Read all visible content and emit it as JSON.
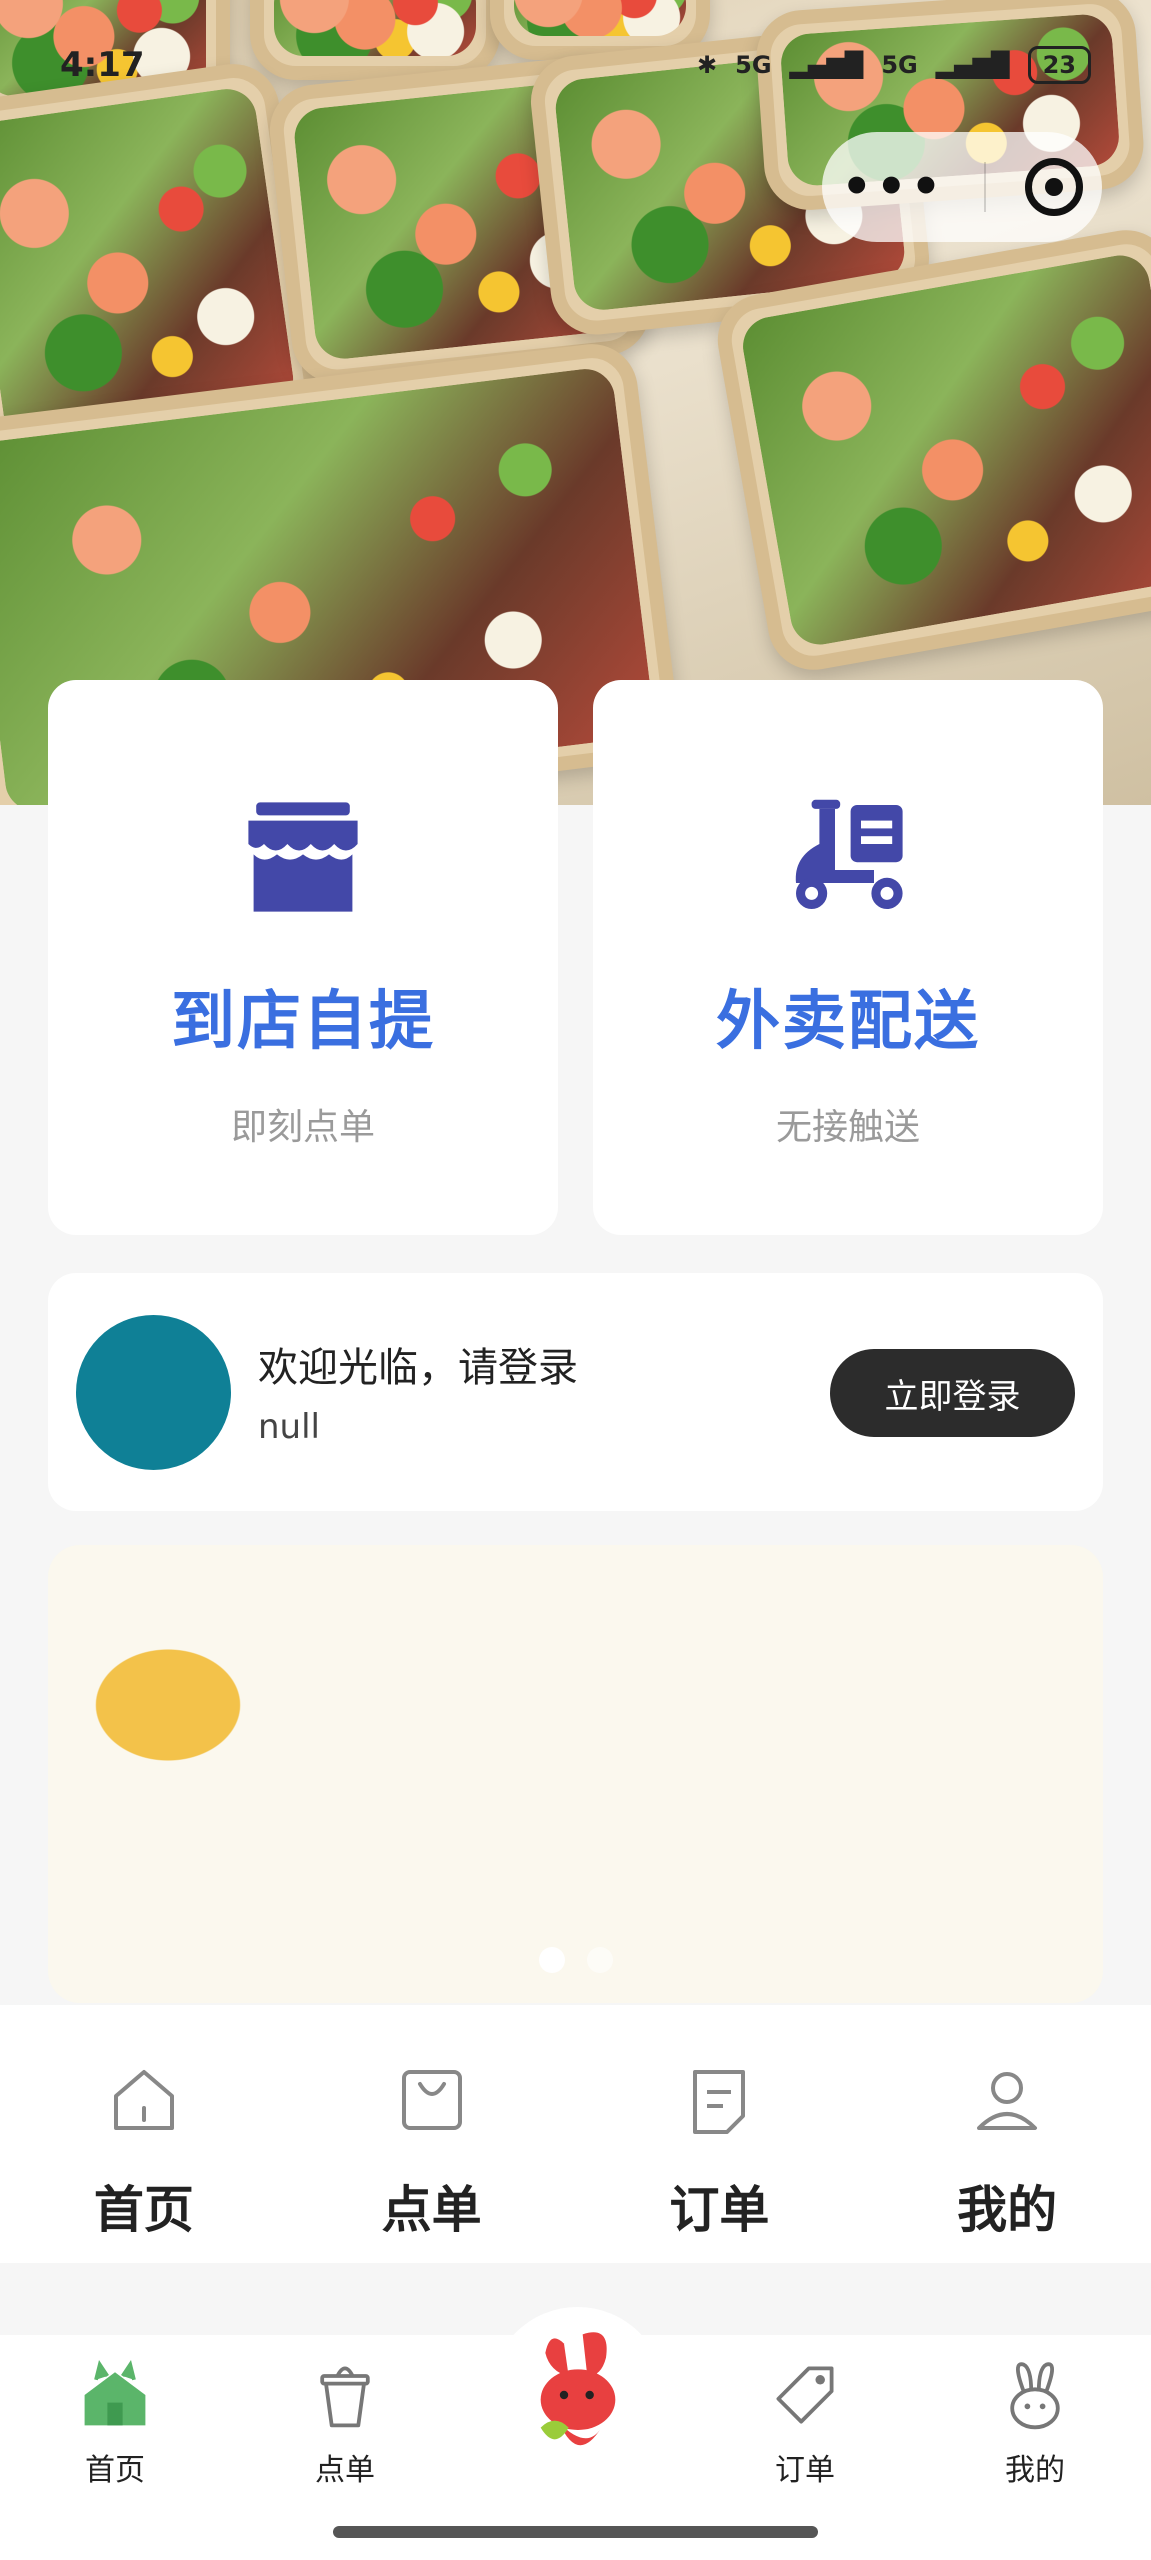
{
  "status_bar": {
    "time": "4:17",
    "network1": "5G",
    "network2": "5G",
    "battery": "23"
  },
  "colors": {
    "accent_blue": "#3a6fe0",
    "icon_indigo": "#4348a8",
    "login_button": "#2c2c2c",
    "avatar": "#0f8096",
    "tab_green": "#5bb56a"
  },
  "services": [
    {
      "title": "到店自提",
      "subtitle": "即刻点单",
      "icon": "storefront-icon"
    },
    {
      "title": "外卖配送",
      "subtitle": "无接触送",
      "icon": "delivery-scooter-icon"
    }
  ],
  "login": {
    "welcome": "欢迎光临，请登录",
    "username": "null",
    "button": "立即登录"
  },
  "banner": {
    "slide_count": 2,
    "active_slide": 1
  },
  "shortcuts": [
    {
      "label": "首页",
      "icon": "home-icon"
    },
    {
      "label": "点单",
      "icon": "bag-icon"
    },
    {
      "label": "订单",
      "icon": "document-icon"
    },
    {
      "label": "我的",
      "icon": "user-icon"
    }
  ],
  "tabbar": [
    {
      "label": "首页",
      "icon": "home-tab-icon",
      "active": true
    },
    {
      "label": "点单",
      "icon": "cup-tab-icon"
    },
    {
      "label": "",
      "icon": "rabbit-mascot-icon"
    },
    {
      "label": "订单",
      "icon": "tag-tab-icon"
    },
    {
      "label": "我的",
      "icon": "rabbit-head-icon"
    }
  ]
}
